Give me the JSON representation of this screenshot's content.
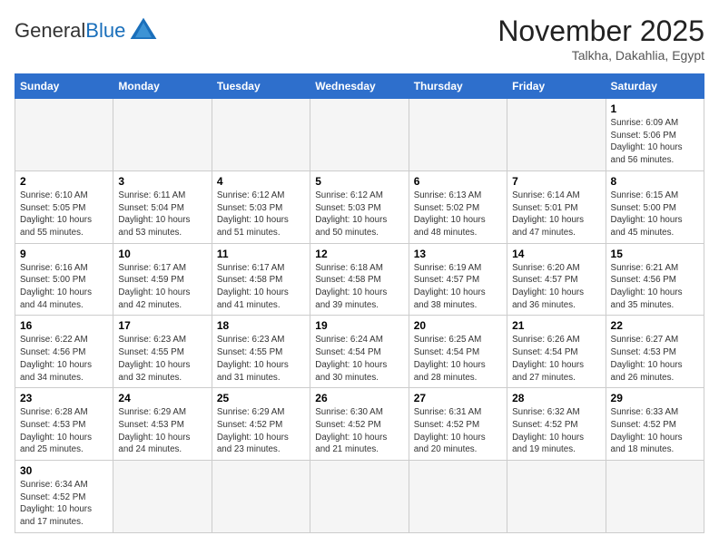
{
  "header": {
    "logo_general": "General",
    "logo_blue": "Blue",
    "month_title": "November 2025",
    "location": "Talkha, Dakahlia, Egypt"
  },
  "weekdays": [
    "Sunday",
    "Monday",
    "Tuesday",
    "Wednesday",
    "Thursday",
    "Friday",
    "Saturday"
  ],
  "days": [
    {
      "date": "",
      "info": ""
    },
    {
      "date": "",
      "info": ""
    },
    {
      "date": "",
      "info": ""
    },
    {
      "date": "",
      "info": ""
    },
    {
      "date": "",
      "info": ""
    },
    {
      "date": "",
      "info": ""
    },
    {
      "date": "1",
      "info": "Sunrise: 6:09 AM\nSunset: 5:06 PM\nDaylight: 10 hours and 56 minutes."
    },
    {
      "date": "2",
      "info": "Sunrise: 6:10 AM\nSunset: 5:05 PM\nDaylight: 10 hours and 55 minutes."
    },
    {
      "date": "3",
      "info": "Sunrise: 6:11 AM\nSunset: 5:04 PM\nDaylight: 10 hours and 53 minutes."
    },
    {
      "date": "4",
      "info": "Sunrise: 6:12 AM\nSunset: 5:03 PM\nDaylight: 10 hours and 51 minutes."
    },
    {
      "date": "5",
      "info": "Sunrise: 6:12 AM\nSunset: 5:03 PM\nDaylight: 10 hours and 50 minutes."
    },
    {
      "date": "6",
      "info": "Sunrise: 6:13 AM\nSunset: 5:02 PM\nDaylight: 10 hours and 48 minutes."
    },
    {
      "date": "7",
      "info": "Sunrise: 6:14 AM\nSunset: 5:01 PM\nDaylight: 10 hours and 47 minutes."
    },
    {
      "date": "8",
      "info": "Sunrise: 6:15 AM\nSunset: 5:00 PM\nDaylight: 10 hours and 45 minutes."
    },
    {
      "date": "9",
      "info": "Sunrise: 6:16 AM\nSunset: 5:00 PM\nDaylight: 10 hours and 44 minutes."
    },
    {
      "date": "10",
      "info": "Sunrise: 6:17 AM\nSunset: 4:59 PM\nDaylight: 10 hours and 42 minutes."
    },
    {
      "date": "11",
      "info": "Sunrise: 6:17 AM\nSunset: 4:58 PM\nDaylight: 10 hours and 41 minutes."
    },
    {
      "date": "12",
      "info": "Sunrise: 6:18 AM\nSunset: 4:58 PM\nDaylight: 10 hours and 39 minutes."
    },
    {
      "date": "13",
      "info": "Sunrise: 6:19 AM\nSunset: 4:57 PM\nDaylight: 10 hours and 38 minutes."
    },
    {
      "date": "14",
      "info": "Sunrise: 6:20 AM\nSunset: 4:57 PM\nDaylight: 10 hours and 36 minutes."
    },
    {
      "date": "15",
      "info": "Sunrise: 6:21 AM\nSunset: 4:56 PM\nDaylight: 10 hours and 35 minutes."
    },
    {
      "date": "16",
      "info": "Sunrise: 6:22 AM\nSunset: 4:56 PM\nDaylight: 10 hours and 34 minutes."
    },
    {
      "date": "17",
      "info": "Sunrise: 6:23 AM\nSunset: 4:55 PM\nDaylight: 10 hours and 32 minutes."
    },
    {
      "date": "18",
      "info": "Sunrise: 6:23 AM\nSunset: 4:55 PM\nDaylight: 10 hours and 31 minutes."
    },
    {
      "date": "19",
      "info": "Sunrise: 6:24 AM\nSunset: 4:54 PM\nDaylight: 10 hours and 30 minutes."
    },
    {
      "date": "20",
      "info": "Sunrise: 6:25 AM\nSunset: 4:54 PM\nDaylight: 10 hours and 28 minutes."
    },
    {
      "date": "21",
      "info": "Sunrise: 6:26 AM\nSunset: 4:54 PM\nDaylight: 10 hours and 27 minutes."
    },
    {
      "date": "22",
      "info": "Sunrise: 6:27 AM\nSunset: 4:53 PM\nDaylight: 10 hours and 26 minutes."
    },
    {
      "date": "23",
      "info": "Sunrise: 6:28 AM\nSunset: 4:53 PM\nDaylight: 10 hours and 25 minutes."
    },
    {
      "date": "24",
      "info": "Sunrise: 6:29 AM\nSunset: 4:53 PM\nDaylight: 10 hours and 24 minutes."
    },
    {
      "date": "25",
      "info": "Sunrise: 6:29 AM\nSunset: 4:52 PM\nDaylight: 10 hours and 23 minutes."
    },
    {
      "date": "26",
      "info": "Sunrise: 6:30 AM\nSunset: 4:52 PM\nDaylight: 10 hours and 21 minutes."
    },
    {
      "date": "27",
      "info": "Sunrise: 6:31 AM\nSunset: 4:52 PM\nDaylight: 10 hours and 20 minutes."
    },
    {
      "date": "28",
      "info": "Sunrise: 6:32 AM\nSunset: 4:52 PM\nDaylight: 10 hours and 19 minutes."
    },
    {
      "date": "29",
      "info": "Sunrise: 6:33 AM\nSunset: 4:52 PM\nDaylight: 10 hours and 18 minutes."
    },
    {
      "date": "30",
      "info": "Sunrise: 6:34 AM\nSunset: 4:52 PM\nDaylight: 10 hours and 17 minutes."
    },
    {
      "date": "",
      "info": ""
    },
    {
      "date": "",
      "info": ""
    },
    {
      "date": "",
      "info": ""
    },
    {
      "date": "",
      "info": ""
    },
    {
      "date": "",
      "info": ""
    },
    {
      "date": "",
      "info": ""
    }
  ]
}
